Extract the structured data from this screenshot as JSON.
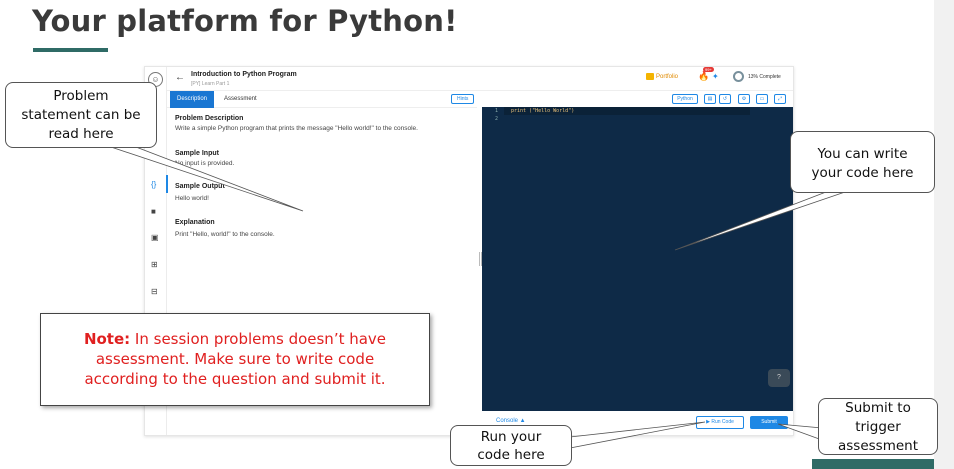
{
  "slide": {
    "title": "Your platform for Python!"
  },
  "app": {
    "program_title": "Introduction to Python Program",
    "program_subtitle": "[PY] Learn Part 1",
    "portfolio_label": "Portfolio",
    "notification_count": "99+",
    "progress_label": "13% Complete",
    "progress_percent": 13,
    "tabs": [
      "Description",
      "Assessment"
    ],
    "hints_label": "Hints",
    "problem": {
      "description_heading": "Problem Description",
      "description_text": "Write a simple Python program that prints the message \"Hello world!\" to the console.",
      "input_heading": "Sample Input",
      "input_text": "No input is provided.",
      "output_heading": "Sample Output",
      "output_text": "Hello world!",
      "explanation_heading": "Explanation",
      "explanation_text": "Print \"Hello, world!\" to the console."
    },
    "editor": {
      "language": "Python",
      "line_numbers": [
        "1",
        "2"
      ],
      "code_line_1": "print (\"Hello World\")",
      "help_label": "?"
    },
    "console_label": "Console ▲",
    "run_label": "▶ Run Code",
    "submit_label": "Submit",
    "colors": {
      "accent": "#1e88e5",
      "editor_bg": "#0e2a47",
      "brand": "#2f6b66"
    }
  },
  "callouts": {
    "problem": [
      "Problem",
      "statement can be",
      "read here"
    ],
    "write": [
      "You can write",
      "your code here"
    ],
    "run": [
      "Run your",
      "code here"
    ],
    "submit": [
      "Submit to",
      "trigger",
      "assessment"
    ]
  },
  "note": {
    "label": "Note:",
    "text_1": " In session problems doesn’t have",
    "text_2": "assessment. Make sure to write code",
    "text_3": "according to the question and submit it."
  }
}
